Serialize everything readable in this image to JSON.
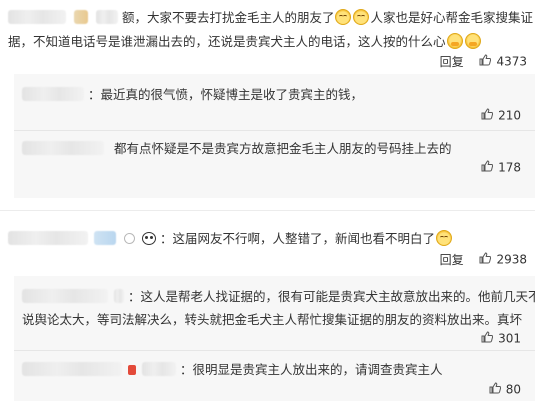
{
  "comments": [
    {
      "line1": "额，大家不要去打扰金毛主人的朋友了",
      "line1b": "人家也是好心帮金毛家搜集证",
      "line2": "据，不知道电话号是谁泄漏出去的，还说是贵宾犬主人的电话，这人按的什么心",
      "reply_label": "回复",
      "likes": "4373",
      "replies": [
        {
          "text": "：最近真的很气愤，怀疑博主是收了贵宾主的钱，",
          "likes": "210"
        },
        {
          "text": "都有点怀疑是不是贵宾方故意把金毛主人朋友的号码挂上去的",
          "likes": "178"
        }
      ]
    },
    {
      "line1": "：这届网友不行啊，人整错了，新闻也看不明白了",
      "reply_label": "回复",
      "likes": "2938",
      "replies": [
        {
          "text": "：这人是帮老人找证据的，很有可能是贵宾犬主故意放出来的。他前几天不还",
          "text2": "说舆论太大，等司法解决么，转头就把金毛犬主人帮忙搜集证据的朋友的资料放出来。真坏",
          "likes": "301"
        },
        {
          "text": "：很明显是贵宾主人放出来的，请调查贵宾主人",
          "likes": "80"
        }
      ]
    }
  ],
  "icons": {
    "like": "thumb-up-icon",
    "laugh_emoji": "laugh-cry-emoji-icon",
    "hug_emoji": "hug-emoji-icon",
    "panda": "panda-icon",
    "badge": "badge-icon"
  },
  "colors": {
    "text": "#333333",
    "panel": "#f7f7f7",
    "divider": "#ececec"
  }
}
